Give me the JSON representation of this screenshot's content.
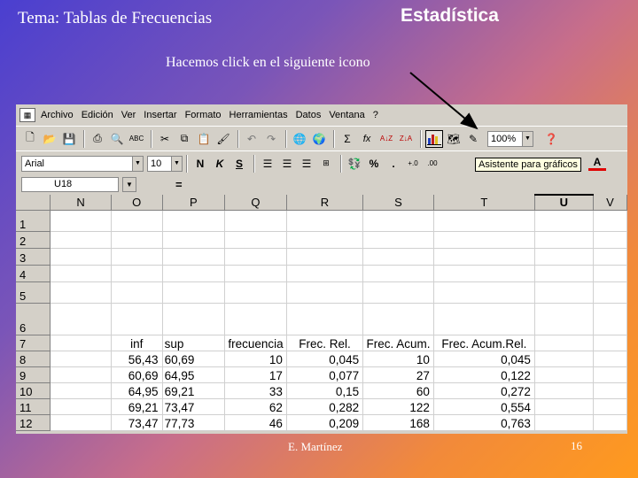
{
  "slide": {
    "title": "Tema: Tablas de Frecuencias",
    "heading": "Estadística",
    "subtitle": "Hacemos click en el siguiente icono",
    "footer": "E. Martínez",
    "page_number": "16"
  },
  "excel": {
    "menu": [
      "Archivo",
      "Edición",
      "Ver",
      "Insertar",
      "Formato",
      "Herramientas",
      "Datos",
      "Ventana",
      "?"
    ],
    "zoom": "100%",
    "font": "Arial",
    "font_size": "10",
    "tooltip": "Asistente para gráficos",
    "name_box": "U18",
    "formula_eq": "=",
    "columns": [
      "N",
      "O",
      "P",
      "Q",
      "R",
      "S",
      "T",
      "U",
      "V"
    ],
    "selected_column": "U",
    "rows": [
      {
        "n": "1",
        "cells": [
          "",
          "",
          "",
          "",
          "",
          "",
          "",
          "",
          ""
        ]
      },
      {
        "n": "2",
        "cells": [
          "",
          "",
          "",
          "",
          "",
          "",
          "",
          "",
          ""
        ]
      },
      {
        "n": "3",
        "cells": [
          "",
          "",
          "",
          "",
          "",
          "",
          "",
          "",
          ""
        ]
      },
      {
        "n": "4",
        "cells": [
          "",
          "",
          "",
          "",
          "",
          "",
          "",
          "",
          ""
        ]
      },
      {
        "n": "5",
        "cells": [
          "",
          "",
          "",
          "",
          "",
          "",
          "",
          "",
          ""
        ]
      },
      {
        "n": "6",
        "cells": [
          "",
          "",
          "",
          "",
          "",
          "",
          "",
          "",
          ""
        ]
      },
      {
        "n": "7",
        "cells": [
          "",
          "inf",
          "sup",
          "frecuencia",
          "Frec. Rel.",
          "Frec. Acum.",
          "Frec. Acum.Rel.",
          "",
          ""
        ]
      },
      {
        "n": "8",
        "cells": [
          "",
          "56,43",
          "60,69",
          "10",
          "0,045",
          "10",
          "0,045",
          "",
          ""
        ]
      },
      {
        "n": "9",
        "cells": [
          "",
          "60,69",
          "64,95",
          "17",
          "0,077",
          "27",
          "0,122",
          "",
          ""
        ]
      },
      {
        "n": "10",
        "cells": [
          "",
          "64,95",
          "69,21",
          "33",
          "0,15",
          "60",
          "0,272",
          "",
          ""
        ]
      },
      {
        "n": "11",
        "cells": [
          "",
          "69,21",
          "73,47",
          "62",
          "0,282",
          "122",
          "0,554",
          "",
          ""
        ]
      },
      {
        "n": "12",
        "cells": [
          "",
          "73,47",
          "77,73",
          "46",
          "0,209",
          "168",
          "0,763",
          "",
          ""
        ]
      }
    ]
  },
  "icons": {
    "standard_toolbar": [
      "new-icon",
      "open-icon",
      "save-icon",
      "print-icon",
      "print-preview-icon",
      "spelling-icon",
      "cut-icon",
      "copy-icon",
      "paste-icon",
      "format-painter-icon",
      "undo-icon",
      "redo-icon",
      "hyperlink-icon",
      "web-toolbar-icon",
      "autosum-icon",
      "function-icon",
      "sort-ascending-icon",
      "sort-descending-icon",
      "chart-wizard-icon",
      "map-icon",
      "drawing-icon",
      "help-icon"
    ],
    "formatting_toolbar": [
      "bold-icon",
      "italic-icon",
      "underline-icon",
      "align-left-icon",
      "align-center-icon",
      "align-right-icon",
      "merge-center-icon",
      "currency-icon",
      "percent-icon",
      "comma-icon",
      "increase-decimal-icon",
      "decrease-decimal-icon",
      "font-color-icon"
    ]
  }
}
